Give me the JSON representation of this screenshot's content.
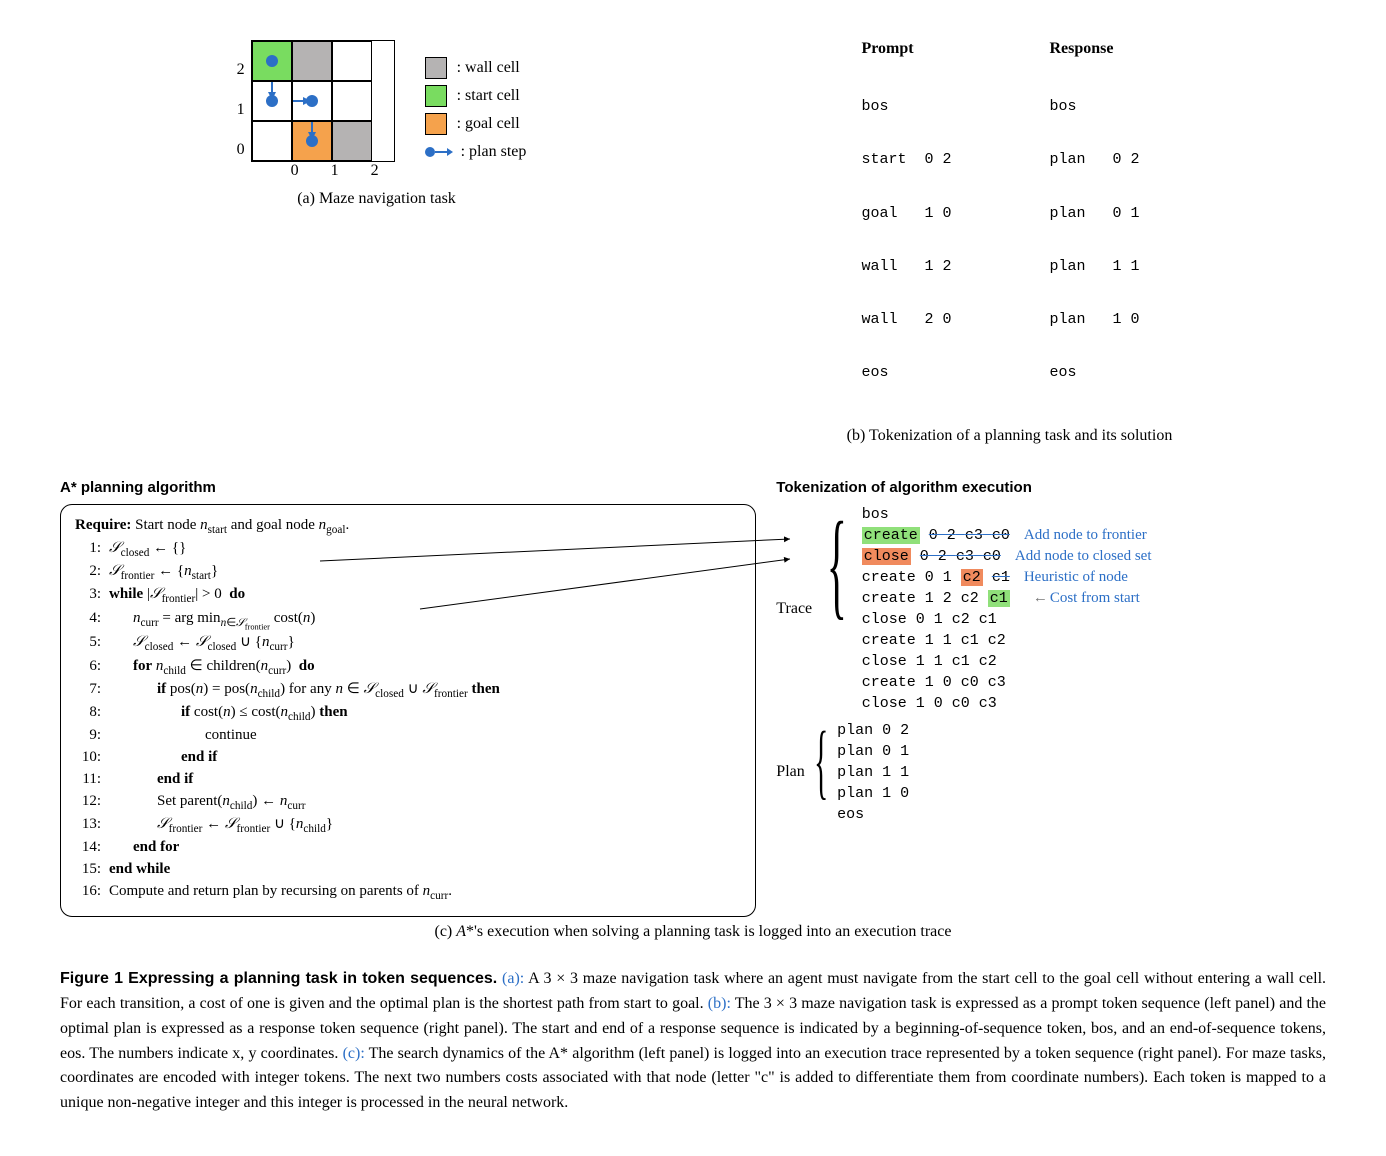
{
  "maze": {
    "ylabels": [
      "2",
      "1",
      "0"
    ],
    "xlabels": [
      "0",
      "1",
      "2"
    ]
  },
  "legend": {
    "wall": ": wall cell",
    "start": ": start cell",
    "goal": ": goal cell",
    "plan": ": plan step"
  },
  "sub_a": "(a) Maze navigation task",
  "sub_b": "(b) Tokenization of a planning task and its solution",
  "sub_c": "(c) A*'s execution when solving a planning task is logged into an execution trace",
  "prompt_header": "Prompt",
  "response_header": "Response",
  "prompt_lines": [
    "bos",
    "start  0 2",
    "goal   1 0",
    "wall   1 2",
    "wall   2 0",
    "eos"
  ],
  "response_lines": [
    "bos",
    "plan   0 2",
    "plan   0 1",
    "plan   1 1",
    "plan   1 0",
    "eos"
  ],
  "sec_algo": "A* planning algorithm",
  "sec_tok": "Tokenization of algorithm execution",
  "algo": {
    "require_pre": "Require:",
    "require_body": " Start node n_start and goal node n_goal.",
    "l1": "𝒮_closed ← {}",
    "l2": "𝒮_frontier ← {n_start}",
    "l3a": "while",
    "l3b": " |𝒮_frontier| > 0 ",
    "l3c": "do",
    "l4": "n_curr = arg min_{n∈𝒮_frontier} cost(n)",
    "l5": "𝒮_closed ← 𝒮_closed ∪ {n_curr}",
    "l6a": "for",
    "l6b": " n_child ∈ children(n_curr) ",
    "l6c": "do",
    "l7a": "if",
    "l7b": " pos(n) = pos(n_child) for any n ∈ 𝒮_closed ∪ 𝒮_frontier ",
    "l7c": "then",
    "l8a": "if",
    "l8b": " cost(n) ≤ cost(n_child) ",
    "l8c": "then",
    "l9": "continue",
    "l10": "end if",
    "l11": "end if",
    "l12": "Set parent(n_child) ← n_curr",
    "l13": "𝒮_frontier ← 𝒮_frontier ∪ {n_child}",
    "l14": "end for",
    "l15": "end while",
    "l16": "Compute and return plan by recursing on parents of n_curr."
  },
  "trace_label": "Trace",
  "plan_label": "Plan",
  "trace_lines": {
    "t0": "bos",
    "t1a": "create",
    "t1b": "0 2",
    "t1c": "c3",
    "t1d": "c0",
    "t2a": "close",
    "t2b": "0 2",
    "t2c": "c3",
    "t2d": "c0",
    "t3a": "create 0 1",
    "t3b": "c2",
    "t3c": "c1",
    "t4a": "create 1 2 c2",
    "t4b": "c1",
    "t5": "close  0 1 c2 c1",
    "t6": "create 1 1 c1 c2",
    "t7": "close  1 1 c1 c2",
    "t8": "create 1 0 c0 c3",
    "t9": "close  1 0 c0 c3"
  },
  "annot": {
    "a1": "Add node to frontier",
    "a2": "Add node to closed set",
    "a3": "Heuristic of node",
    "a4": "Cost from start"
  },
  "plan_lines": [
    "plan   0 2",
    "plan   0 1",
    "plan   1 1",
    "plan   1 0",
    "eos"
  ],
  "fig": {
    "lead": "Figure 1   Expressing a planning task in token sequences.",
    "a_label": "(a):",
    "a_body": " A 3 × 3 maze navigation task where an agent must navigate from the start cell to the goal cell without entering a wall cell. For each transition, a cost of one is given and the optimal plan is the shortest path from start to goal. ",
    "b_label": "(b):",
    "b_body": " The 3 × 3 maze navigation task is expressed as a prompt token sequence (left panel) and the optimal plan is expressed as a response token sequence (right panel). The start and end of a response sequence is indicated by a beginning-of-sequence token, bos, and an end-of-sequence tokens, eos. The numbers indicate x, y coordinates. ",
    "c_label": "(c):",
    "c_body": " The search dynamics of the A* algorithm (left panel) is logged into an execution trace represented by a token sequence (right panel). For maze tasks, coordinates are encoded with integer tokens. The next two numbers costs associated with that node (letter \"c\" is added to differentiate them from coordinate numbers). Each token is mapped to a unique non-negative integer and this integer is processed in the neural network."
  },
  "chart_data": {
    "type": "table",
    "title": "3x3 maze navigation instance",
    "grid_size": [
      3,
      3
    ],
    "start": [
      0,
      2
    ],
    "goal": [
      1,
      0
    ],
    "walls": [
      [
        1,
        2
      ],
      [
        2,
        0
      ]
    ],
    "optimal_plan": [
      [
        0,
        2
      ],
      [
        0,
        1
      ],
      [
        1,
        1
      ],
      [
        1,
        0
      ]
    ],
    "prompt_tokens": [
      "bos",
      "start 0 2",
      "goal 1 0",
      "wall 1 2",
      "wall 2 0",
      "eos"
    ],
    "response_tokens": [
      "bos",
      "plan 0 2",
      "plan 0 1",
      "plan 1 1",
      "plan 1 0",
      "eos"
    ],
    "execution_trace": [
      {
        "op": "create",
        "x": 0,
        "y": 2,
        "h": 3,
        "g": 0
      },
      {
        "op": "close",
        "x": 0,
        "y": 2,
        "h": 3,
        "g": 0
      },
      {
        "op": "create",
        "x": 0,
        "y": 1,
        "h": 2,
        "g": 1
      },
      {
        "op": "create",
        "x": 1,
        "y": 2,
        "h": 2,
        "g": 1
      },
      {
        "op": "close",
        "x": 0,
        "y": 1,
        "h": 2,
        "g": 1
      },
      {
        "op": "create",
        "x": 1,
        "y": 1,
        "h": 1,
        "g": 2
      },
      {
        "op": "close",
        "x": 1,
        "y": 1,
        "h": 1,
        "g": 2
      },
      {
        "op": "create",
        "x": 1,
        "y": 0,
        "h": 0,
        "g": 3
      },
      {
        "op": "close",
        "x": 1,
        "y": 0,
        "h": 0,
        "g": 3
      }
    ]
  }
}
